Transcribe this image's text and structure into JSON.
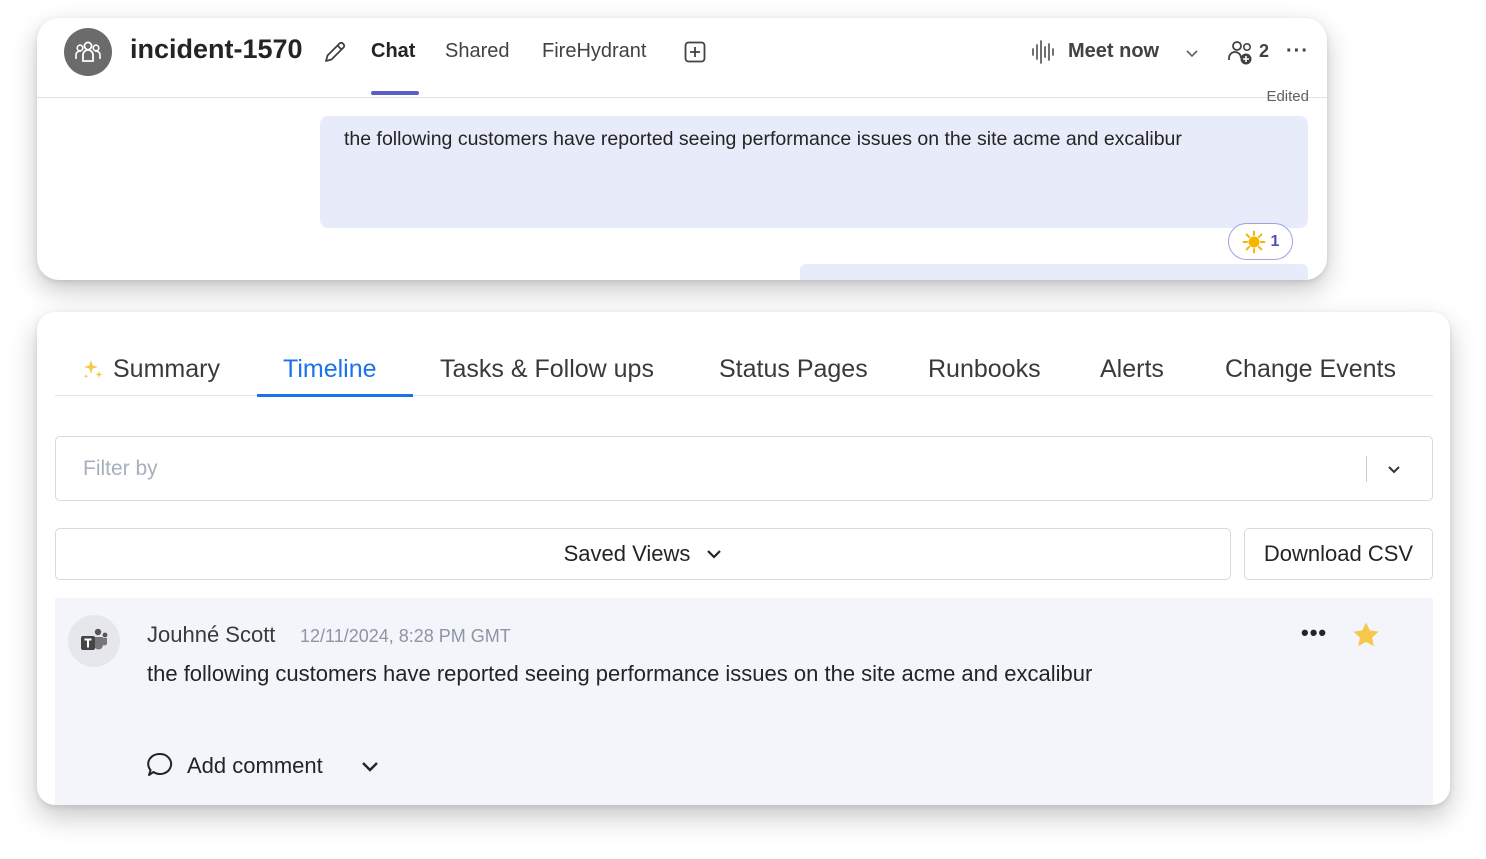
{
  "teams": {
    "channel_title": "incident-1570",
    "tabs": [
      {
        "label": "Chat",
        "active": true
      },
      {
        "label": "Shared",
        "active": false
      },
      {
        "label": "FireHydrant",
        "active": false
      }
    ],
    "meet_now_label": "Meet now",
    "participants_count": "2",
    "more_label": "···",
    "accent_color": "#5b5fc7",
    "message": {
      "edited_label": "Edited",
      "text": "the following customers have reported seeing performance issues on the site acme and excalibur",
      "reaction": {
        "icon": "sun-emoji-icon",
        "count": "1"
      }
    }
  },
  "firehydrant": {
    "tabs": [
      {
        "label": "Summary",
        "active": false,
        "icon": "sparkle-icon"
      },
      {
        "label": "Timeline",
        "active": true
      },
      {
        "label": "Tasks & Follow ups",
        "active": false
      },
      {
        "label": "Status Pages",
        "active": false
      },
      {
        "label": "Runbooks",
        "active": false
      },
      {
        "label": "Alerts",
        "active": false
      },
      {
        "label": "Change Events",
        "active": false
      }
    ],
    "active_tab_color": "#1a73e8",
    "filter": {
      "placeholder": "Filter by",
      "value": ""
    },
    "saved_views_label": "Saved Views",
    "download_csv_label": "Download CSV",
    "timeline_entry": {
      "author": "Jouhné Scott",
      "timestamp": "12/11/2024, 8:28 PM GMT",
      "text": "the following customers have reported seeing performance issues on the site acme and excalibur",
      "more_label": "•••",
      "starred": true,
      "star_color": "#f5c84b",
      "add_comment_label": "Add comment"
    }
  }
}
